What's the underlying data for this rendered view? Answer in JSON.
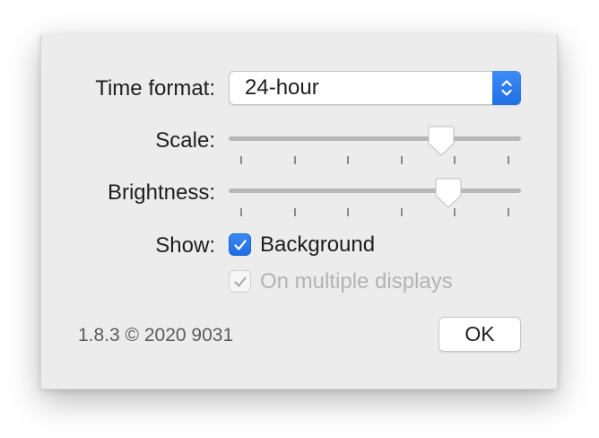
{
  "colors": {
    "accent": "#2a7af0",
    "panel_bg": "#ececec",
    "disabled_text": "#b3b3b3"
  },
  "labels": {
    "time_format": "Time format:",
    "scale": "Scale:",
    "brightness": "Brightness:",
    "show": "Show:"
  },
  "time_format_select": {
    "value": "24-hour",
    "icon": "up-down-chevrons-icon"
  },
  "scale_slider": {
    "value_fraction": 0.75,
    "tick_count": 6
  },
  "brightness_slider": {
    "value_fraction": 0.78,
    "tick_count": 6
  },
  "show_options": [
    {
      "label": "Background",
      "checked": true,
      "enabled": true
    },
    {
      "label": "On multiple displays",
      "checked": true,
      "enabled": false
    }
  ],
  "footer": {
    "version_text": "1.8.3 © 2020 9031",
    "ok_label": "OK"
  }
}
